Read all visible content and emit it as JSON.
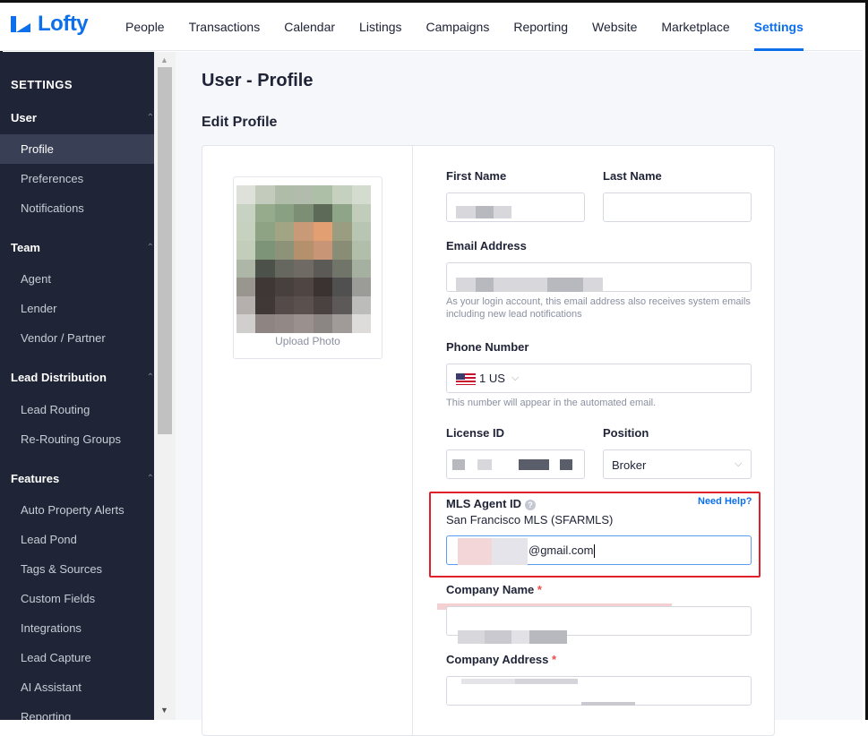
{
  "brand": {
    "name": "Lofty",
    "color": "#0d6fea"
  },
  "nav": {
    "items": [
      "People",
      "Transactions",
      "Calendar",
      "Listings",
      "Campaigns",
      "Reporting",
      "Website",
      "Marketplace",
      "Settings"
    ],
    "active": "Settings"
  },
  "sidebar": {
    "title": "SETTINGS",
    "groups": {
      "user": {
        "label": "User",
        "items": [
          "Profile",
          "Preferences",
          "Notifications"
        ]
      },
      "team": {
        "label": "Team",
        "items": [
          "Agent",
          "Lender",
          "Vendor / Partner"
        ]
      },
      "lead_distribution": {
        "label": "Lead Distribution",
        "items": [
          "Lead Routing",
          "Re-Routing Groups"
        ]
      },
      "features": {
        "label": "Features",
        "items": [
          "Auto Property Alerts",
          "Lead Pond",
          "Tags & Sources",
          "Custom Fields",
          "Integrations",
          "Lead Capture",
          "AI Assistant",
          "Reporting"
        ]
      }
    },
    "active_item": "Profile"
  },
  "page": {
    "title": "User - Profile",
    "section": "Edit Profile",
    "upload_photo": "Upload Photo"
  },
  "form": {
    "first_name_label": "First Name",
    "last_name_label": "Last Name",
    "email_label": "Email Address",
    "email_hint": "As your login account, this email address also receives system emails including new lead notifications",
    "phone_label": "Phone Number",
    "phone_country": "1 US",
    "phone_hint": "This number will appear in the automated email.",
    "license_label": "License ID",
    "position_label": "Position",
    "position_value": "Broker",
    "mls_label": "MLS Agent ID",
    "mls_help": "Need Help?",
    "mls_source": "San Francisco MLS (SFARMLS)",
    "mls_value": "@gmail.com",
    "company_name_label": "Company Name",
    "company_address_label": "Company Address",
    "required_mark": "*"
  },
  "colors": {
    "sidebar_bg": "#1f2536",
    "highlight": "#e0202c",
    "accent": "#0d6fea"
  }
}
